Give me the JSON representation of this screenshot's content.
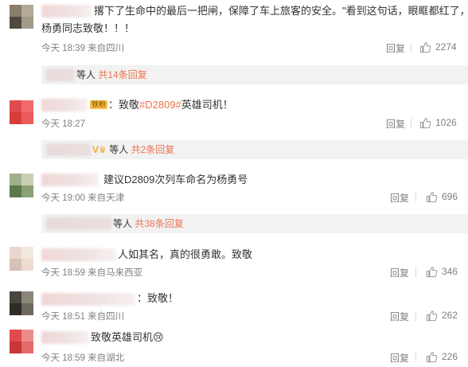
{
  "comments": [
    {
      "text_line1": "撂下了生命中的最后一把闸，保障了车上旅客的安全。\"看到这句话，眼眶都红了，像",
      "text_line2": "杨勇同志致敬！！！",
      "time": "今天 18:39 来自四川",
      "reply": "回复",
      "likes": "2274",
      "sub_text": "等人",
      "sub_link": "共14条回复"
    },
    {
      "badge": "铁粉",
      "text_pre": "：致敬",
      "hashtag": "#D2809#",
      "text_post": "英雄司机！",
      "time": "今天 18:27",
      "reply": "回复",
      "likes": "1026",
      "sub_v": "V",
      "sub_crown": "♛",
      "sub_text": "等人",
      "sub_link": "共2条回复"
    },
    {
      "text": "建议D2809次列车命名为杨勇号",
      "time": "今天 19:00 来自天津",
      "reply": "回复",
      "likes": "696",
      "sub_text": "等人",
      "sub_link": "共38条回复"
    },
    {
      "text": "人如其名，真的很勇敢。致敬",
      "time": "今天 18:59 来自马来西亚",
      "reply": "回复",
      "likes": "346"
    },
    {
      "text": "：致敬！",
      "time": "今天 18:51 来自四川",
      "reply": "回复",
      "likes": "262"
    },
    {
      "text": "致敬英雄司机",
      "emoji": "😢",
      "time": "今天 18:59 来自湖北",
      "reply": "回复",
      "likes": "226"
    }
  ],
  "icons": {
    "like": "thumbs-up-icon"
  },
  "colors": {
    "link": "#eb7350",
    "meta": "#808080",
    "sub_bg": "#f2f2f2"
  }
}
